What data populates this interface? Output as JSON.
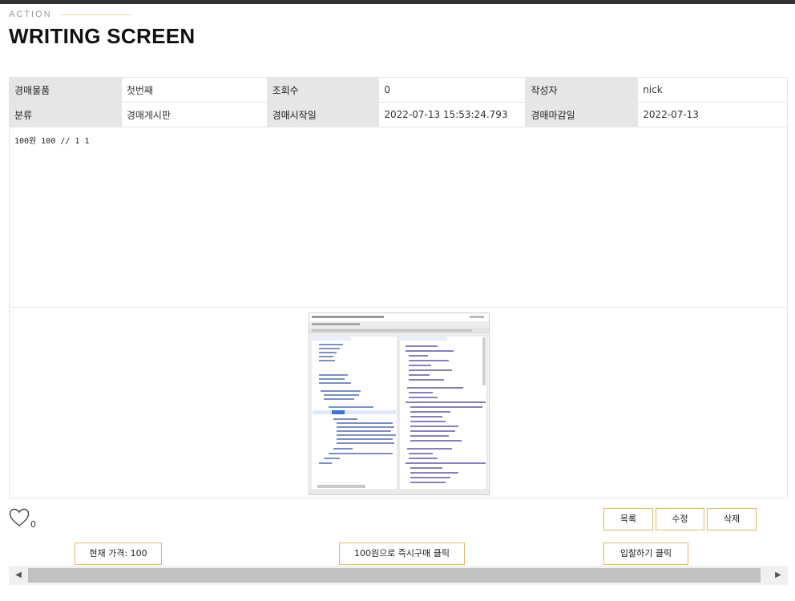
{
  "header": {
    "eyebrow": "ACTION",
    "title": "WRITING SCREEN"
  },
  "info": {
    "row1": {
      "item_label": "경매물품",
      "item_value": "첫번째",
      "views_label": "조회수",
      "views_value": "0",
      "author_label": "작성자",
      "author_value": "nick"
    },
    "row2": {
      "category_label": "분류",
      "category_value": "경매게시판",
      "start_label": "경매시작일",
      "start_value": "2022-07-13 15:53:24.793",
      "end_label": "경매마감일",
      "end_value": "2022-07-13"
    }
  },
  "content": {
    "text": "100원 100 // 1 1"
  },
  "likes": {
    "count": "0"
  },
  "actions": {
    "list": "목록",
    "edit": "수정",
    "delete": "삭제",
    "current_price": "현재 가격: 100",
    "buy_now": "100원으로 즉시구매 클릭",
    "bid": "입찰하기 클릭"
  },
  "colors": {
    "button_border": "#e0b867",
    "label_bg": "#e6e6e6",
    "topbar": "#333333"
  }
}
